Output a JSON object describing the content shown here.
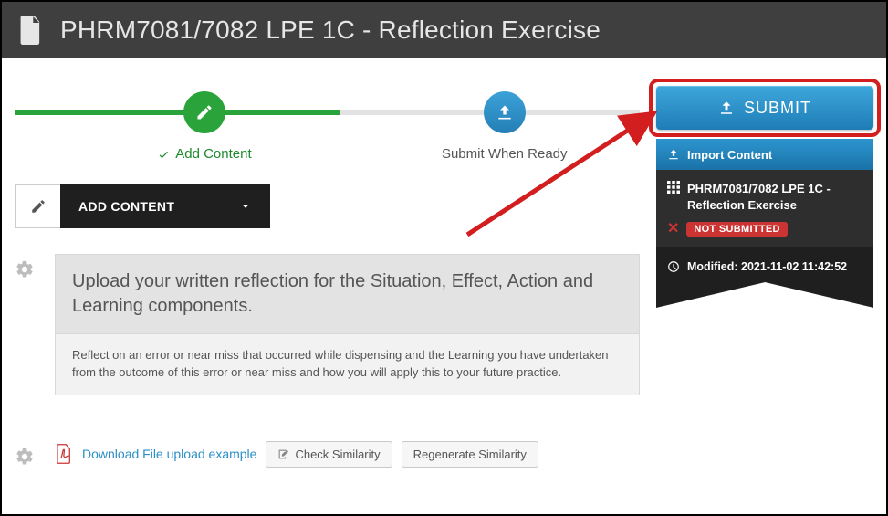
{
  "header": {
    "title": "PHRM7081/7082 LPE 1C - Reflection Exercise"
  },
  "stepper": {
    "step1_label": "Add Content",
    "step2_label": "Submit When Ready"
  },
  "add_content": {
    "label": "ADD CONTENT"
  },
  "instructions": {
    "heading": "Upload your written reflection for the Situation, Effect, Action and Learning components.",
    "body": "Reflect on an error or near miss that occurred while dispensing and the Learning you have undertaken from the outcome of this error or near miss and how you will apply this to your future practice."
  },
  "tools": {
    "download_link": "Download File upload example",
    "check_similarity": "Check Similarity",
    "regenerate_similarity": "Regenerate Similarity"
  },
  "sidebar": {
    "submit_label": "SUBMIT",
    "import_label": "Import Content",
    "item_title": "PHRM7081/7082 LPE 1C - Reflection Exercise",
    "status_badge": "NOT SUBMITTED",
    "modified_label": "Modified:",
    "modified_value": "2021-11-02 11:42:52"
  }
}
